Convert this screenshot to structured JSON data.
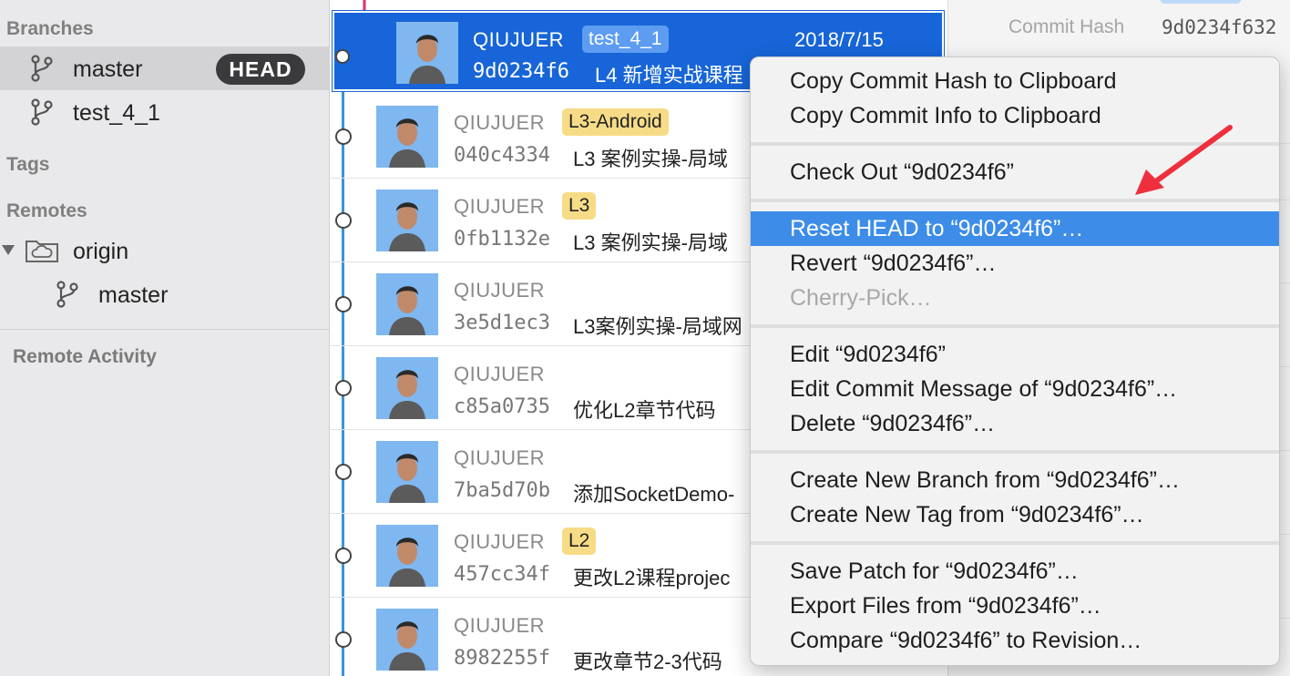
{
  "sidebar": {
    "branches_header": "Branches",
    "branches": [
      {
        "label": "master",
        "badge": "HEAD",
        "selected": true
      },
      {
        "label": "test_4_1"
      }
    ],
    "tags_header": "Tags",
    "remotes_header": "Remotes",
    "remote": {
      "label": "origin",
      "branches": [
        {
          "label": "master"
        }
      ]
    },
    "remote_activity": "Remote Activity"
  },
  "commits": [
    {
      "author": "QIUJUER",
      "tag": "test_4_1",
      "date": "2018/7/15",
      "hash": "9d0234f6",
      "message": "L4 新增实战课程",
      "selected": true
    },
    {
      "author": "QIUJUER",
      "tag": "L3-Android",
      "hash": "040c4334",
      "message": "L3 案例实操-局域"
    },
    {
      "author": "QIUJUER",
      "tag": "L3",
      "hash": "0fb1132e",
      "message": "L3 案例实操-局域"
    },
    {
      "author": "QIUJUER",
      "hash": "3e5d1ec3",
      "message": "L3案例实操-局域网"
    },
    {
      "author": "QIUJUER",
      "hash": "c85a0735",
      "message": "优化L2章节代码"
    },
    {
      "author": "QIUJUER",
      "hash": "7ba5d70b",
      "message": "添加SocketDemo-"
    },
    {
      "author": "QIUJUER",
      "tag": "L2",
      "hash": "457cc34f",
      "message": "更改L2课程projec"
    },
    {
      "author": "QIUJUER",
      "hash": "8982255f",
      "message": "更改章节2-3代码"
    }
  ],
  "details": {
    "commit_hash_label": "Commit Hash",
    "commit_hash_value": "9d0234f632"
  },
  "context_menu": {
    "groups": [
      [
        {
          "label": "Copy Commit Hash to Clipboard"
        },
        {
          "label": "Copy Commit Info to Clipboard"
        }
      ],
      [
        {
          "label": "Check Out “9d0234f6”"
        }
      ],
      [
        {
          "label": "Reset HEAD to “9d0234f6”…",
          "highlighted": true
        },
        {
          "label": "Revert “9d0234f6”…"
        },
        {
          "label": "Cherry-Pick…",
          "disabled": true
        }
      ],
      [
        {
          "label": "Edit “9d0234f6”"
        },
        {
          "label": "Edit Commit Message of “9d0234f6”…"
        },
        {
          "label": "Delete “9d0234f6”…"
        }
      ],
      [
        {
          "label": "Create New Branch from “9d0234f6”…"
        },
        {
          "label": "Create New Tag from “9d0234f6”…"
        }
      ],
      [
        {
          "label": "Save Patch for “9d0234f6”…"
        },
        {
          "label": "Export Files from “9d0234f6”…"
        },
        {
          "label": "Compare “9d0234f6” to Revision…"
        }
      ]
    ]
  },
  "colors": {
    "selection": "#1765d8",
    "menu_highlight": "#3d8de8",
    "tag_yellow": "#f7dc87",
    "graph_blue": "#3b93d8",
    "graph_pink": "#e0306a",
    "arrow_red": "#ee2f3e"
  },
  "icons": {
    "branch": "branch-icon",
    "folder": "cloud-folder-icon",
    "avatar": "avatar-portrait",
    "annotation": "red-arrow"
  }
}
